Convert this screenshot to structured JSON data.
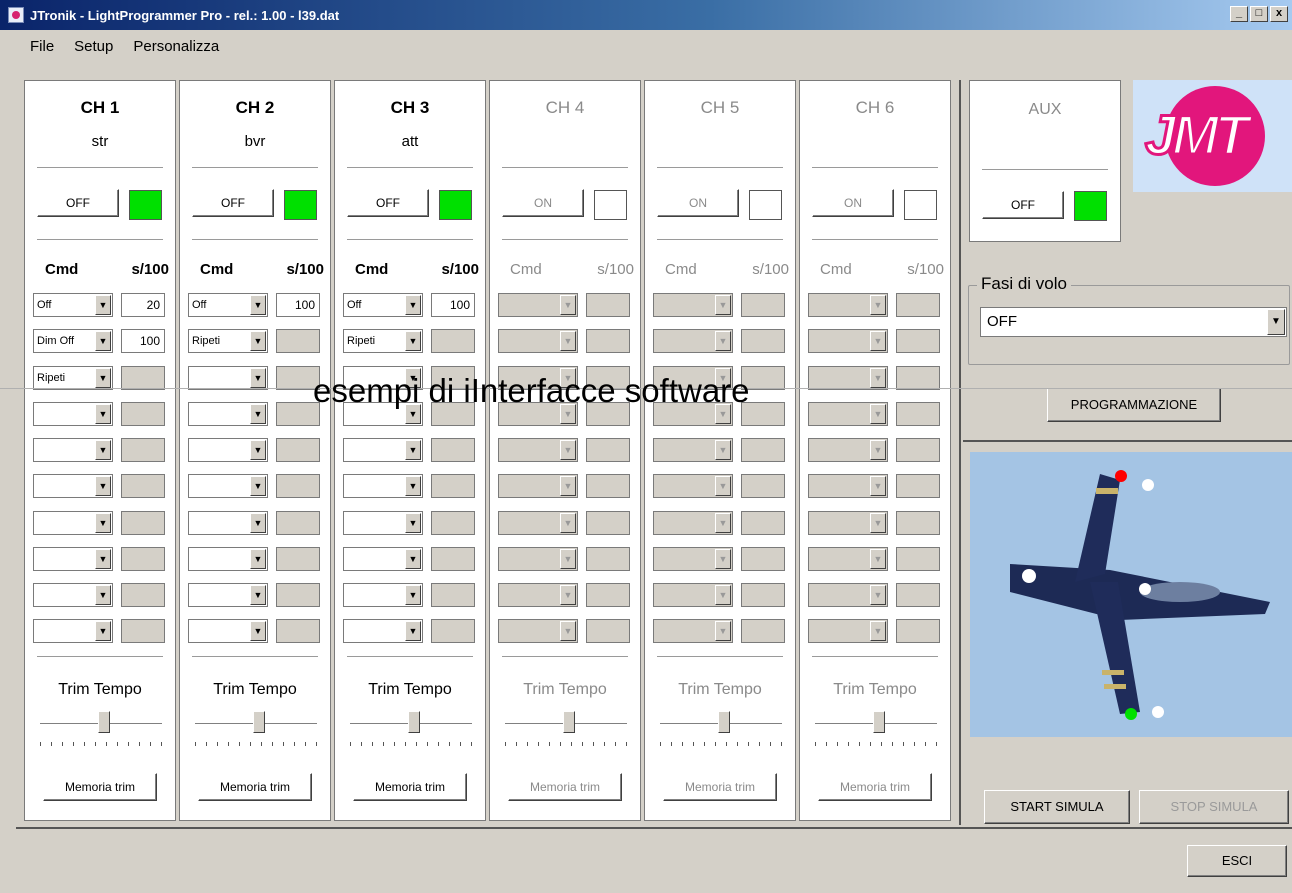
{
  "window": {
    "title": "JTronik - LightProgrammer Pro - rel.: 1.00 - l39.dat",
    "min": "_",
    "max": "□",
    "close": "x"
  },
  "menu": [
    "File",
    "Setup",
    "Personalizza"
  ],
  "headers": {
    "cmd": "Cmd",
    "time": "s/100"
  },
  "channels": [
    {
      "title": "CH 1",
      "sub": "str",
      "btn": "OFF",
      "led": "green",
      "rows": [
        {
          "cmd": "Off",
          "val": "20"
        },
        {
          "cmd": "Dim Off",
          "val": "100"
        },
        {
          "cmd": "Ripeti",
          "val": ""
        },
        {
          "cmd": "",
          "val": ""
        },
        {
          "cmd": "",
          "val": ""
        },
        {
          "cmd": "",
          "val": ""
        },
        {
          "cmd": "",
          "val": ""
        },
        {
          "cmd": "",
          "val": ""
        },
        {
          "cmd": "",
          "val": ""
        },
        {
          "cmd": "",
          "val": ""
        }
      ],
      "trim": "Trim Tempo",
      "mem": "Memoria trim"
    },
    {
      "title": "CH 2",
      "sub": "bvr",
      "btn": "OFF",
      "led": "green",
      "rows": [
        {
          "cmd": "Off",
          "val": "100"
        },
        {
          "cmd": "Ripeti",
          "val": ""
        },
        {
          "cmd": "",
          "val": ""
        },
        {
          "cmd": "",
          "val": ""
        },
        {
          "cmd": "",
          "val": ""
        },
        {
          "cmd": "",
          "val": ""
        },
        {
          "cmd": "",
          "val": ""
        },
        {
          "cmd": "",
          "val": ""
        },
        {
          "cmd": "",
          "val": ""
        },
        {
          "cmd": "",
          "val": ""
        }
      ],
      "trim": "Trim Tempo",
      "mem": "Memoria trim"
    },
    {
      "title": "CH 3",
      "sub": "att",
      "btn": "OFF",
      "led": "green",
      "rows": [
        {
          "cmd": "Off",
          "val": "100"
        },
        {
          "cmd": "Ripeti",
          "val": ""
        },
        {
          "cmd": "",
          "val": ""
        },
        {
          "cmd": "",
          "val": ""
        },
        {
          "cmd": "",
          "val": ""
        },
        {
          "cmd": "",
          "val": ""
        },
        {
          "cmd": "",
          "val": ""
        },
        {
          "cmd": "",
          "val": ""
        },
        {
          "cmd": "",
          "val": ""
        },
        {
          "cmd": "",
          "val": ""
        }
      ],
      "trim": "Trim Tempo",
      "mem": "Memoria trim"
    },
    {
      "title": "CH 4",
      "sub": "",
      "btn": "ON",
      "led": "white",
      "rows": [
        {
          "cmd": "",
          "val": ""
        },
        {
          "cmd": "",
          "val": ""
        },
        {
          "cmd": "",
          "val": ""
        },
        {
          "cmd": "",
          "val": ""
        },
        {
          "cmd": "",
          "val": ""
        },
        {
          "cmd": "",
          "val": ""
        },
        {
          "cmd": "",
          "val": ""
        },
        {
          "cmd": "",
          "val": ""
        },
        {
          "cmd": "",
          "val": ""
        },
        {
          "cmd": "",
          "val": ""
        }
      ],
      "trim": "Trim Tempo",
      "mem": "Memoria trim"
    },
    {
      "title": "CH 5",
      "sub": "",
      "btn": "ON",
      "led": "white",
      "rows": [
        {
          "cmd": "",
          "val": ""
        },
        {
          "cmd": "",
          "val": ""
        },
        {
          "cmd": "",
          "val": ""
        },
        {
          "cmd": "",
          "val": ""
        },
        {
          "cmd": "",
          "val": ""
        },
        {
          "cmd": "",
          "val": ""
        },
        {
          "cmd": "",
          "val": ""
        },
        {
          "cmd": "",
          "val": ""
        },
        {
          "cmd": "",
          "val": ""
        },
        {
          "cmd": "",
          "val": ""
        }
      ],
      "trim": "Trim Tempo",
      "mem": "Memoria trim"
    },
    {
      "title": "CH 6",
      "sub": "",
      "btn": "ON",
      "led": "white",
      "rows": [
        {
          "cmd": "",
          "val": ""
        },
        {
          "cmd": "",
          "val": ""
        },
        {
          "cmd": "",
          "val": ""
        },
        {
          "cmd": "",
          "val": ""
        },
        {
          "cmd": "",
          "val": ""
        },
        {
          "cmd": "",
          "val": ""
        },
        {
          "cmd": "",
          "val": ""
        },
        {
          "cmd": "",
          "val": ""
        },
        {
          "cmd": "",
          "val": ""
        },
        {
          "cmd": "",
          "val": ""
        }
      ],
      "trim": "Trim Tempo",
      "mem": "Memoria trim"
    }
  ],
  "aux": {
    "title": "AUX",
    "btn": "OFF",
    "led": "green"
  },
  "logo": {
    "text": "JMT"
  },
  "fasi": {
    "legend": "Fasi di volo",
    "value": "OFF"
  },
  "buttons": {
    "programmazione": "PROGRAMMAZIONE",
    "start": "START SIMULA",
    "stop": "STOP SIMULA",
    "esci": "ESCI"
  },
  "overlay": "esempi di iInterfacce software",
  "colors": {
    "led_green": "#00e000",
    "accent": "#e2167c"
  }
}
